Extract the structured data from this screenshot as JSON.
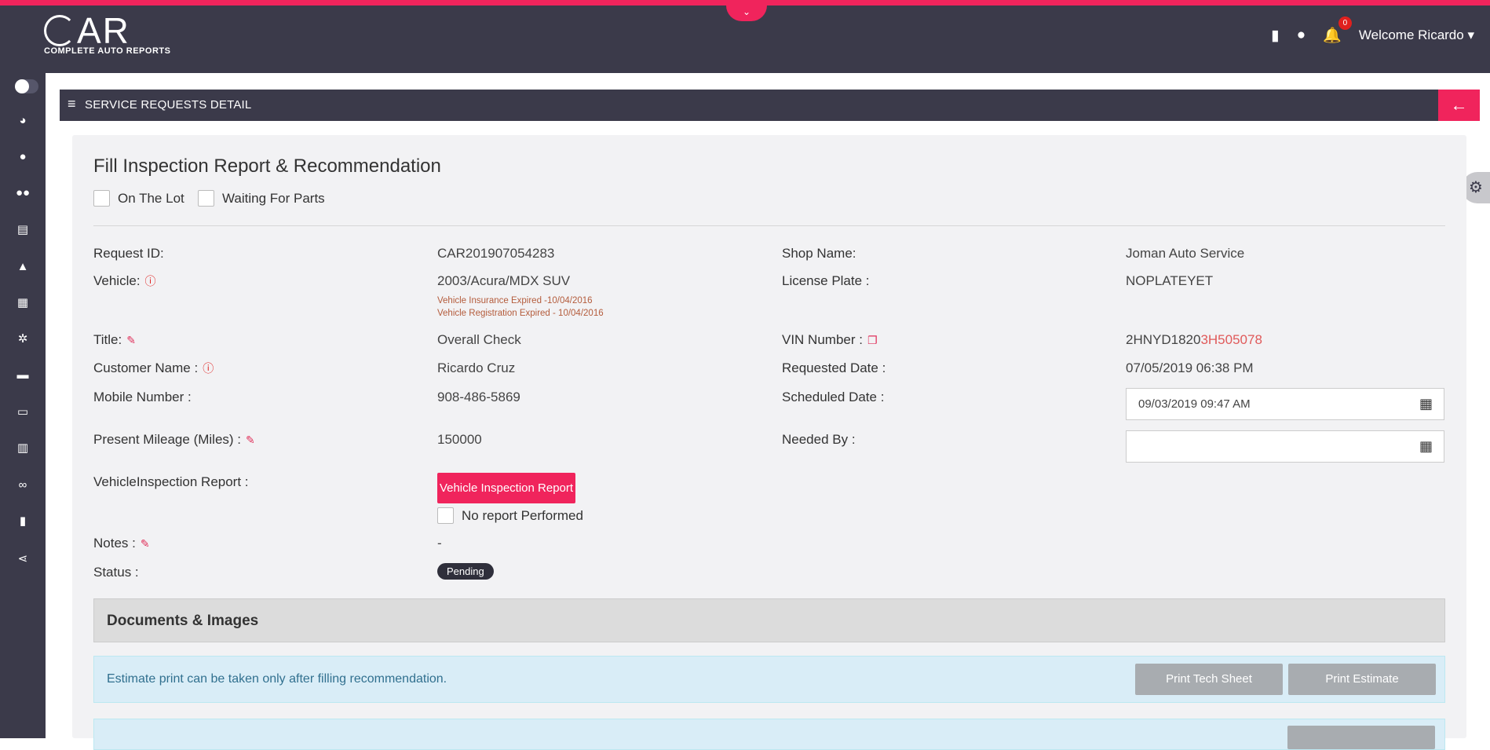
{
  "header": {
    "logo_text": "AR",
    "logo_subtitle": "COMPLETE AUTO REPORTS",
    "notification_count": "0",
    "welcome": "Welcome Ricardo",
    "icons": [
      "book-icon",
      "chat-icon",
      "bell-icon",
      "caret-down-icon"
    ]
  },
  "sidebar": {
    "items": [
      "dashboard-icon",
      "user-icon",
      "users-icon",
      "document-icon",
      "warning-icon",
      "calendar-icon",
      "cogs-icon",
      "briefcase-icon",
      "monitor-icon",
      "bar-chart-icon",
      "handshake-icon",
      "book-icon",
      "share-icon"
    ]
  },
  "section": {
    "title": "SERVICE REQUESTS DETAIL"
  },
  "card": {
    "title": "Fill Inspection Report & Recommendation",
    "checkboxes": {
      "on_lot": "On The Lot",
      "waiting_parts": "Waiting For Parts"
    },
    "fields": {
      "request_id": {
        "label": "Request ID:",
        "value": "CAR201907054283"
      },
      "shop_name": {
        "label": "Shop Name:",
        "value": "Joman Auto Service"
      },
      "vehicle": {
        "label": "Vehicle:",
        "value": "2003/Acura/MDX SUV",
        "insurance_warn": "Vehicle Insurance Expired -10/04/2016",
        "registration_warn": "Vehicle Registration Expired - 10/04/2016"
      },
      "license_plate": {
        "label": "License Plate :",
        "value": "NOPLATEYET"
      },
      "title": {
        "label": "Title:",
        "value": "Overall Check"
      },
      "vin": {
        "label": "VIN Number :",
        "value_prefix": "2HNYD1820",
        "value_suffix": "3H505078"
      },
      "customer_name": {
        "label": "Customer Name :",
        "value": "Ricardo Cruz"
      },
      "requested_date": {
        "label": "Requested Date :",
        "value": "07/05/2019 06:38 PM"
      },
      "mobile": {
        "label": "Mobile Number :",
        "value": "908-486-5869"
      },
      "scheduled_date": {
        "label": "Scheduled Date :",
        "value": "09/03/2019 09:47 AM"
      },
      "mileage": {
        "label": "Present Mileage (Miles) :",
        "value": "150000"
      },
      "needed_by": {
        "label": "Needed By :",
        "value": ""
      },
      "inspection_report": {
        "label": "VehicleInspection Report :",
        "button": "Vehicle Inspection Report",
        "no_report": "No report Performed"
      },
      "notes": {
        "label": "Notes :",
        "value": "-"
      },
      "status": {
        "label": "Status :",
        "value": "Pending"
      }
    },
    "documents_title": "Documents & Images",
    "alert_text": "Estimate print can be taken only after filling recommendation.",
    "print_tech_sheet": "Print Tech Sheet",
    "print_estimate": "Print Estimate"
  }
}
